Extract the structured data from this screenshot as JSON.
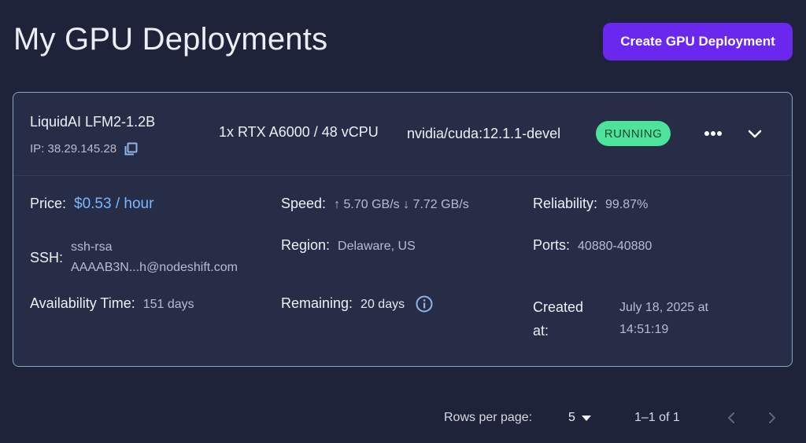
{
  "page": {
    "title": "My GPU Deployments"
  },
  "actions": {
    "create_label": "Create GPU Deployment"
  },
  "deployment": {
    "name": "LiquidAI LFM2-1.2B",
    "ip": "IP: 38.29.145.28",
    "gpu": "1x RTX A6000 / 48 vCPU",
    "image": "nvidia/cuda:12.1.1-devel",
    "status": "RUNNING",
    "details": {
      "price_label": "Price:",
      "price_value": "$0.53 / hour",
      "ssh_label": "SSH:",
      "ssh_value_line1": "ssh-rsa",
      "ssh_value_line2": "AAAAB3N...h@nodeshift.com",
      "availability_label": "Availability Time:",
      "availability_value": "151 days",
      "speed_label": "Speed:",
      "speed_value": "↑ 5.70 GB/s ↓ 7.72 GB/s",
      "region_label": "Region:",
      "region_value": "Delaware, US",
      "remaining_label": "Remaining:",
      "remaining_value": "20 days",
      "reliability_label": "Reliability:",
      "reliability_value": "99.87%",
      "ports_label": "Ports:",
      "ports_value": "40880-40880",
      "created_label_line1": "Created",
      "created_label_line2": "at:",
      "created_value_line1": "July 18, 2025 at",
      "created_value_line2": "14:51:19"
    }
  },
  "pagination": {
    "rows_label": "Rows per page:",
    "rows_value": "5",
    "range": "1–1 of 1"
  },
  "colors": {
    "background": "#1e2339",
    "card": "#272d46",
    "accent": "#6a28ef",
    "status_running": "#4ee39a",
    "price": "#78b8ff"
  }
}
